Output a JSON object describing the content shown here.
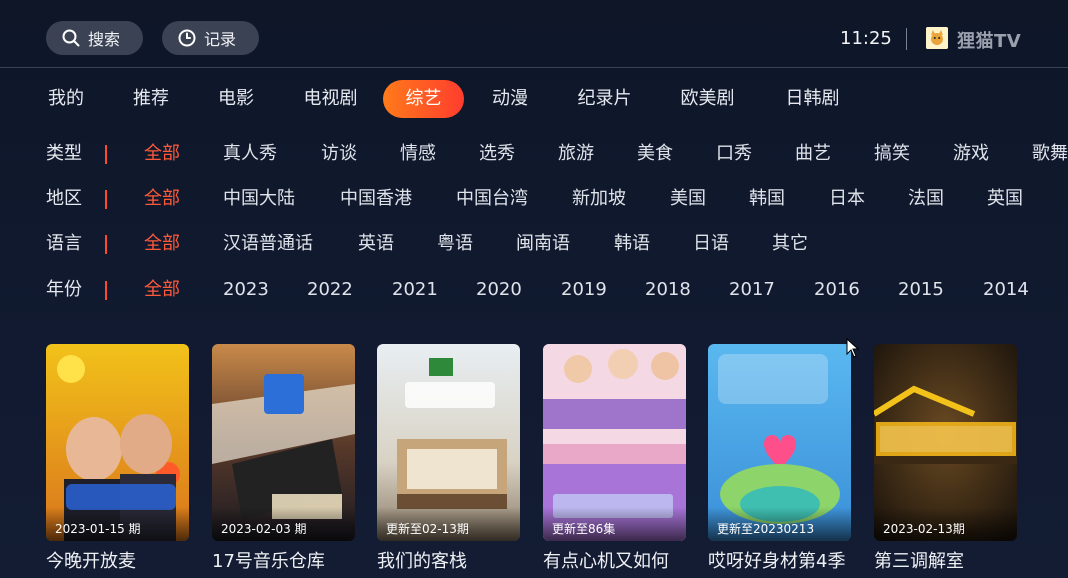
{
  "header": {
    "search_label": "搜索",
    "history_label": "记录",
    "time": "11:25",
    "brand": "狸猫TV"
  },
  "nav": {
    "items": [
      "我的",
      "推荐",
      "电影",
      "电视剧",
      "综艺",
      "动漫",
      "纪录片",
      "欧美剧",
      "日韩剧"
    ],
    "active": "综艺"
  },
  "filters": [
    {
      "label": "类型",
      "options": [
        "全部",
        "真人秀",
        "访谈",
        "情感",
        "选秀",
        "旅游",
        "美食",
        "口秀",
        "曲艺",
        "搞笑",
        "游戏",
        "歌舞"
      ],
      "selected": "全部"
    },
    {
      "label": "地区",
      "options": [
        "全部",
        "中国大陆",
        "中国香港",
        "中国台湾",
        "新加坡",
        "美国",
        "韩国",
        "日本",
        "法国",
        "英国"
      ],
      "selected": "全部"
    },
    {
      "label": "语言",
      "options": [
        "全部",
        "汉语普通话",
        "英语",
        "粤语",
        "闽南语",
        "韩语",
        "日语",
        "其它"
      ],
      "selected": "全部"
    },
    {
      "label": "年份",
      "options": [
        "全部",
        "2023",
        "2022",
        "2021",
        "2020",
        "2019",
        "2018",
        "2017",
        "2016",
        "2015",
        "2014"
      ],
      "selected": "全部"
    }
  ],
  "cards": [
    {
      "title": "今晚开放麦",
      "badge": "2023-01-15 期"
    },
    {
      "title": "17号音乐仓库",
      "badge": "2023-02-03 期"
    },
    {
      "title": "我们的客栈",
      "badge": "更新至02-13期"
    },
    {
      "title": "有点心机又如何",
      "badge": "更新至86集"
    },
    {
      "title": "哎呀好身材第4季",
      "badge": "更新至20230213"
    },
    {
      "title": "第三调解室",
      "badge": "2023-02-13期"
    }
  ],
  "colors": {
    "accent": "#ff4a2a",
    "active_pill_start": "#ff7a1a",
    "active_pill_end": "#ff3d2e",
    "background": "#0e1628"
  }
}
